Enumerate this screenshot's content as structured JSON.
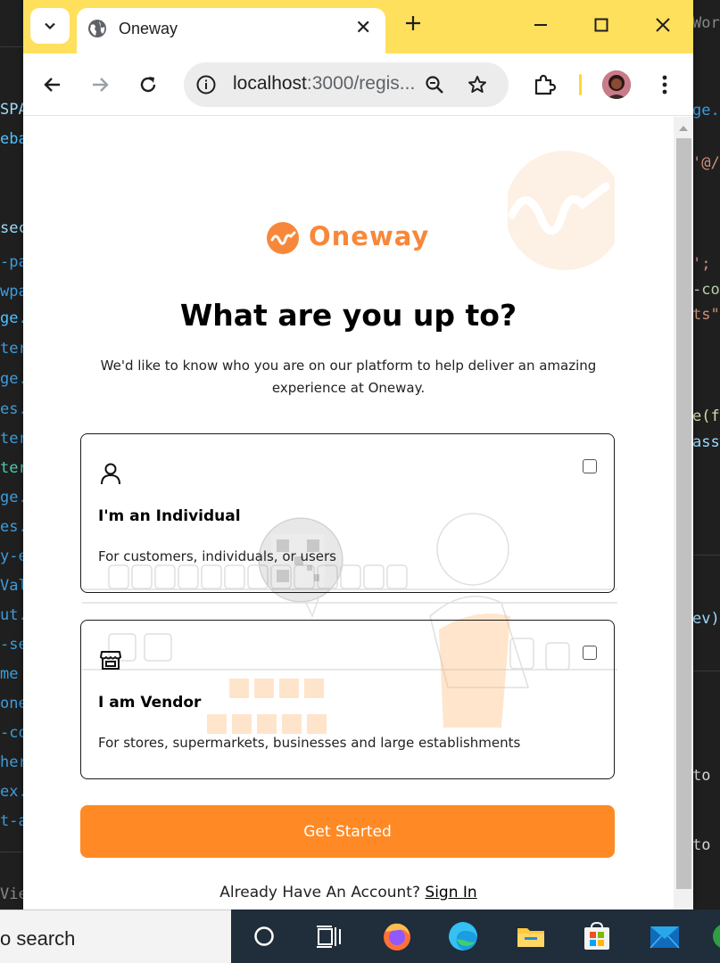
{
  "browser": {
    "tab_title": "Oneway",
    "url_host": "localhost",
    "url_rest": ":3000/regis..."
  },
  "page": {
    "logo_text": "Oneway",
    "heading": "What are you up to?",
    "subtext": "We'd like to know who you are on our platform to help deliver an amazing experience at Oneway.",
    "options": [
      {
        "title": "I'm an Individual",
        "description": "For customers, individuals, or users",
        "icon": "person-icon",
        "checked": false
      },
      {
        "title": "I am Vendor",
        "description": "For stores, supermarkets, businesses and large establishments",
        "icon": "store-icon",
        "checked": false
      }
    ],
    "cta_label": "Get Started",
    "signin_prompt": "Already Have An Account?",
    "signin_link": "Sign In"
  },
  "taskbar": {
    "search_text": "o search",
    "icons": [
      "cortana-icon",
      "task-view-icon",
      "firefox-icon",
      "edge-icon",
      "file-explorer-icon",
      "store-icon",
      "mail-icon"
    ]
  },
  "background_ide": {
    "left_fragments": [
      "SPA",
      "eba",
      "sec",
      "-pa",
      "wpa",
      "ge.t",
      "ter",
      "ge.t",
      "es.",
      "ter",
      "ter",
      "ge.t",
      "es.",
      "y-e",
      "Val",
      "ut.t",
      "-se",
      "me",
      "one",
      "-co",
      "her",
      "ex.",
      "t-a",
      "Vie"
    ],
    "right_fragments": [
      "Work",
      "ge.t",
      "'@/",
      "';",
      "-co",
      "ts\"",
      "e(f",
      "assw",
      "ev)",
      "to",
      "to"
    ]
  },
  "colors": {
    "accent": "#ff8a25",
    "title_bar": "#ffe05c",
    "logo": "#f7883b"
  }
}
